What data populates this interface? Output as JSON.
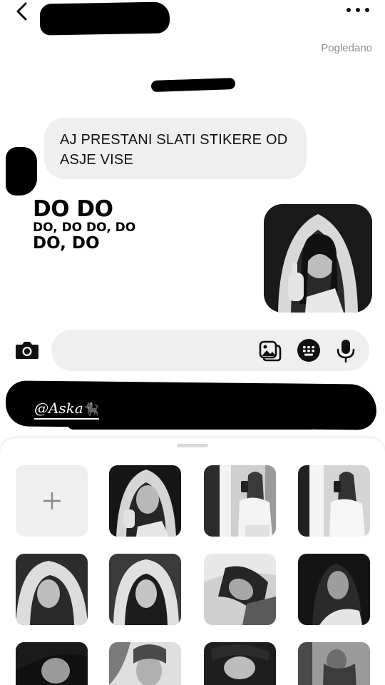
{
  "header": {
    "back_icon": "chevron-left-icon",
    "more_icon": "more-horizontal-icon",
    "seen_label": "Pogledano"
  },
  "messages": {
    "incoming_text": "AJ PRESTANI SLATI STIKERE OD ASJE VISE",
    "sticker": {
      "line1": "DO DO",
      "line2": "DO, DO DO, DO",
      "line3": "DO, DO"
    },
    "photo_message": "photo"
  },
  "composer": {
    "camera_icon": "camera-icon",
    "gallery_icon": "gallery-icon",
    "sticker_icon": "sticker-icon",
    "mic_icon": "microphone-icon"
  },
  "caption": {
    "tag": "@Aska",
    "emoji": "🐈‍⬛"
  },
  "sheet": {
    "add_icon": "plus-icon",
    "thumbnails": 11
  },
  "colors": {
    "bubble_bg": "#efefef",
    "seen_text": "#8e8e8e",
    "redaction": "#000000"
  }
}
